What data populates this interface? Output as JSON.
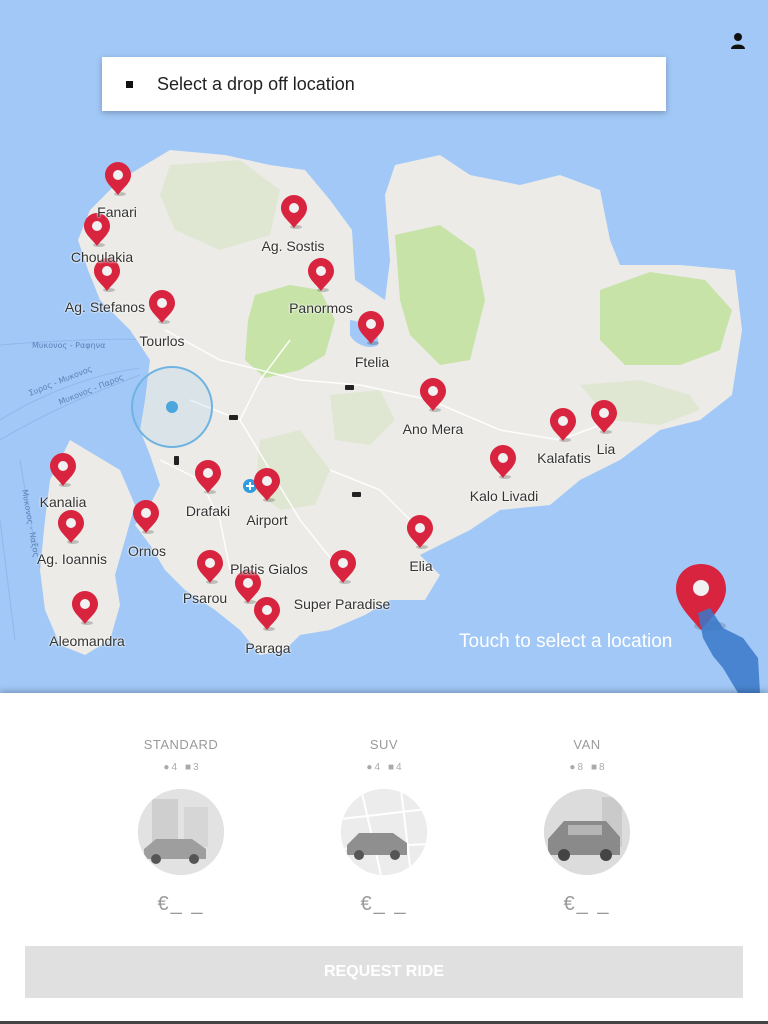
{
  "search": {
    "placeholder": "Select a drop off location"
  },
  "map": {
    "hint": "Touch to select a location",
    "road_labels": [
      "Μυκονος - Ραφηνα",
      "Συρος - Μυκονος",
      "Μυκονος - Παρος",
      "Μυκονος - Ναξος"
    ],
    "places": [
      "Fanari",
      "Choulakia",
      "Ag. Sostis",
      "Ag. Stefanos",
      "Panormos",
      "Tourlos",
      "Ftelia",
      "Ano Mera",
      "Lia",
      "Kalafatis",
      "Kalo Livadi",
      "Kanalia",
      "Drafaki",
      "Airport",
      "Ornos",
      "Ag. Ioannis",
      "Elia",
      "Platis Gialos",
      "Psarou",
      "Super Paradise",
      "Paraga",
      "Aleomandra"
    ],
    "colors": {
      "water": "#a1c8f7",
      "land": "#ecebe7",
      "park": "#c7e3a7",
      "pin": "#d8243f"
    }
  },
  "vehicles": [
    {
      "name": "STANDARD",
      "passengers": "4",
      "luggage": "3",
      "price": "€_ _"
    },
    {
      "name": "SUV",
      "passengers": "4",
      "luggage": "4",
      "price": "€_ _"
    },
    {
      "name": "VAN",
      "passengers": "8",
      "luggage": "8",
      "price": "€_ _"
    }
  ],
  "request_button": "REQUEST RIDE",
  "icons": {
    "profile": "person-icon",
    "pin": "map-pin-icon",
    "plane": "airport-icon"
  }
}
